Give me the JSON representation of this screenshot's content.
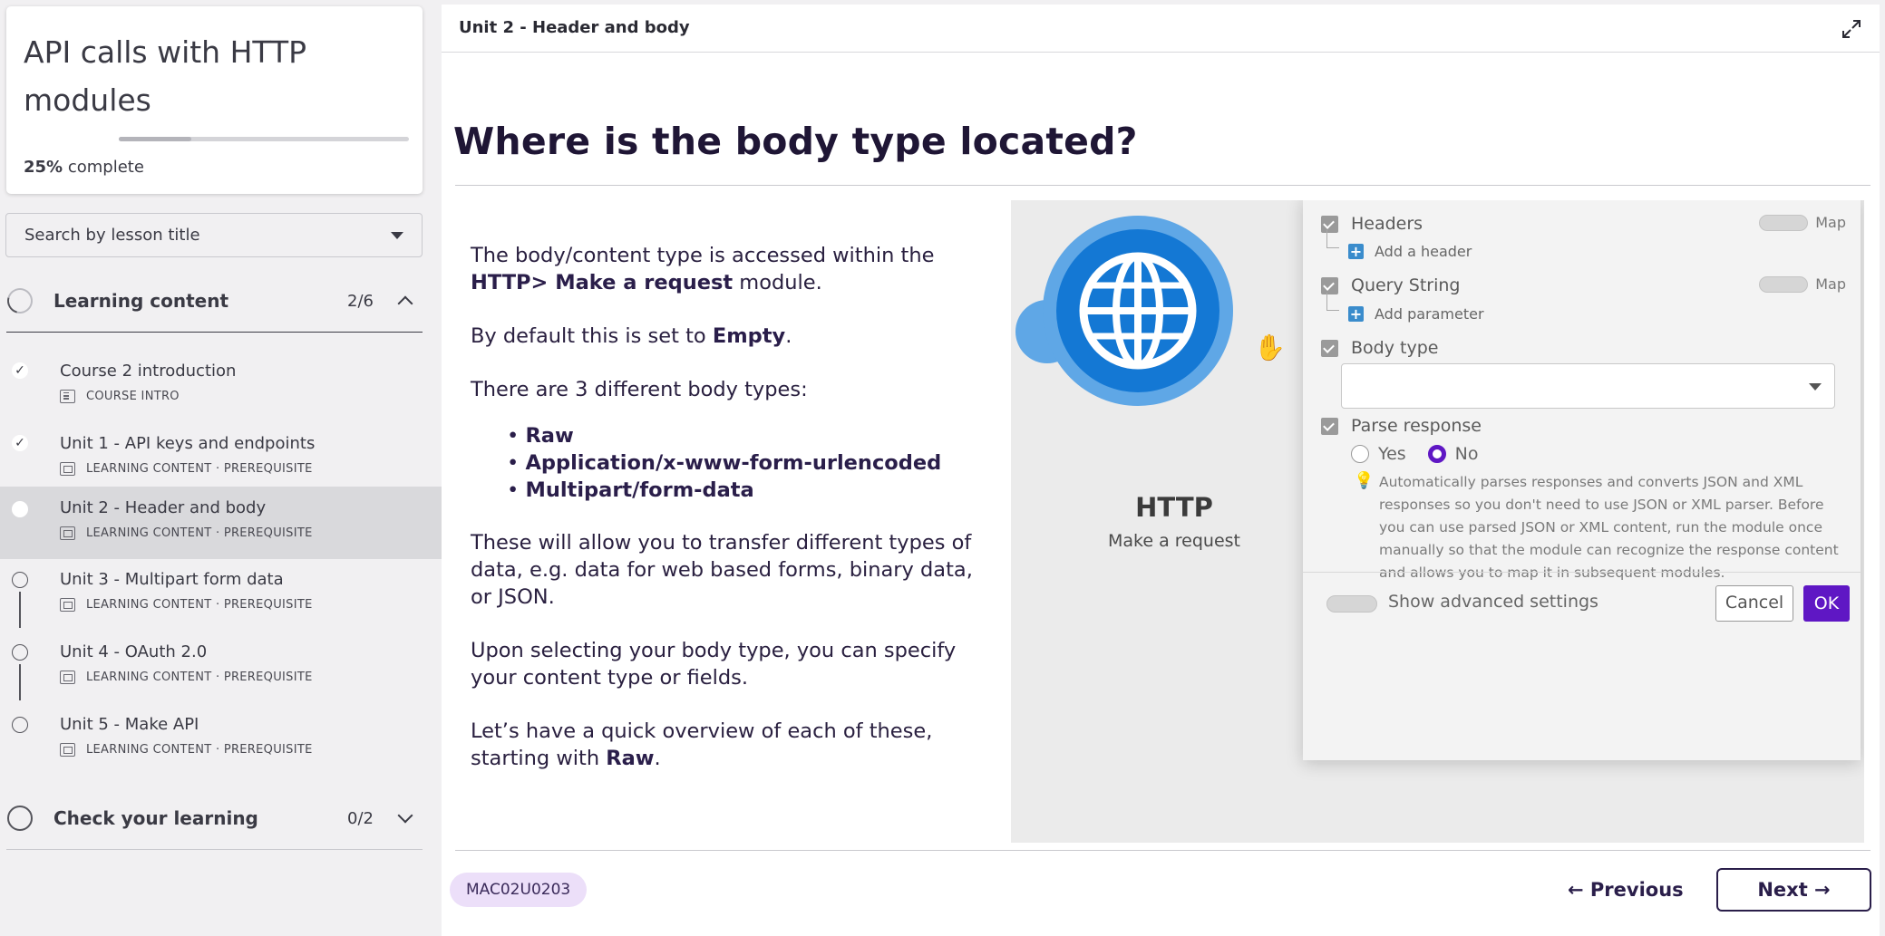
{
  "course": {
    "title": "API calls with HTTP modules",
    "progress_pct": "25%",
    "progress_fraction": 0.25,
    "progress_suffix": "complete"
  },
  "search": {
    "placeholder": "Search by lesson title"
  },
  "sections": [
    {
      "label": "Learning content",
      "count": "2/6",
      "expanded": true
    },
    {
      "label": "Check your learning",
      "count": "0/2",
      "expanded": false
    }
  ],
  "lessons": [
    {
      "title": "Course 2 introduction",
      "meta": "COURSE INTRO",
      "done": true
    },
    {
      "title": "Unit 1 - API keys and endpoints",
      "meta": "LEARNING CONTENT · PREREQUISITE",
      "done": true
    },
    {
      "title": "Unit 2 - Header and body",
      "meta": "LEARNING CONTENT · PREREQUISITE",
      "active": true
    },
    {
      "title": "Unit 3 - Multipart form data",
      "meta": "LEARNING CONTENT · PREREQUISITE"
    },
    {
      "title": "Unit 4 - OAuth 2.0",
      "meta": "LEARNING CONTENT · PREREQUISITE"
    },
    {
      "title": "Unit 5 - Make API",
      "meta": "LEARNING CONTENT · PREREQUISITE"
    }
  ],
  "topbar": {
    "breadcrumb": "Unit 2 - Header and body"
  },
  "content": {
    "heading": "Where is the body type located?",
    "p1_a": "The body/content type is accessed within the ",
    "p1_b": "HTTP> Make a request",
    "p1_c": " module.",
    "p2_a": "By default this is set to ",
    "p2_b": "Empty",
    "p2_c": ".",
    "p3": "There are 3 different body types:",
    "bullets": [
      "Raw",
      "Application/x-www-form-urlencoded",
      "Multipart/form-data"
    ],
    "p4": "These will allow you to transfer different types of data, e.g. data for web based forms, binary data, or JSON.",
    "p5": "Upon selecting your body type, you can specify your content type or fields.",
    "p6_a": "Let’s have a quick overview of each of these, starting with ",
    "p6_b": "Raw",
    "p6_c": "."
  },
  "screenshot": {
    "module_name": "HTTP",
    "module_action": "Make a request",
    "headers_label": "Headers",
    "add_header": "Add a header",
    "query_label": "Query String",
    "add_parameter": "Add parameter",
    "map_label": "Map",
    "body_type_label": "Body type",
    "parse_label": "Parse response",
    "yes": "Yes",
    "no": "No",
    "hint": "Automatically parses responses and converts JSON and XML responses so you don't need to use JSON or XML parser. Before you can use parsed JSON or XML content, run the module once manually so that the module can recognize the response content and allows you to map it in subsequent modules.",
    "advanced": "Show advanced settings",
    "cancel": "Cancel",
    "ok": "OK"
  },
  "footer": {
    "code": "MAC02U0203",
    "previous": "← Previous",
    "next": "Next →"
  },
  "colors": {
    "accent": "#5f17c4",
    "heading": "#1f1635",
    "http_blue": "#1478d4"
  }
}
